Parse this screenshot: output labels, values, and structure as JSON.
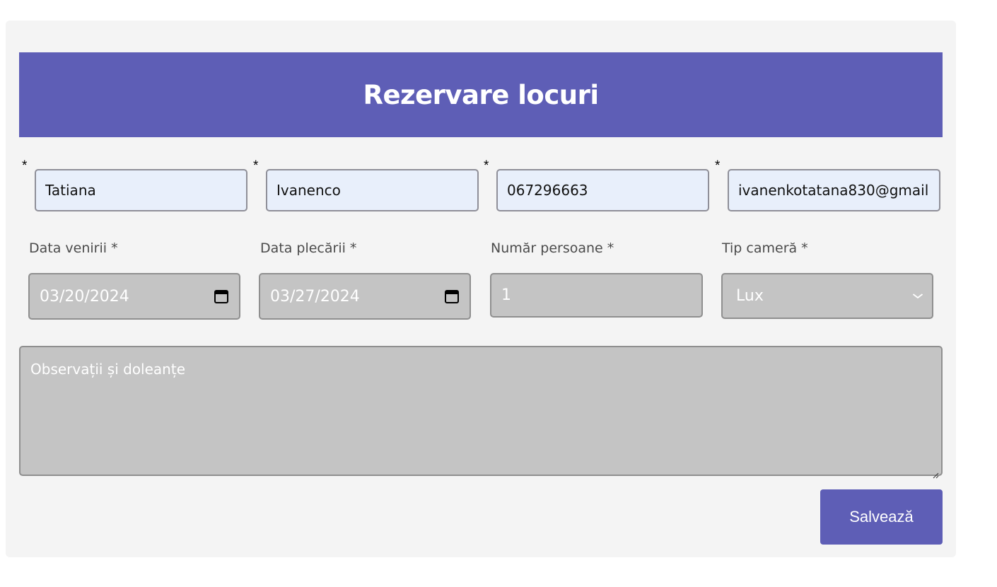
{
  "form": {
    "title": "Rezervare locuri",
    "required_marker": "*",
    "first_name": "Tatiana",
    "last_name": "Ivanenco",
    "phone": "067296663",
    "email": "ivanenkotatana830@gmail",
    "arrival_label": "Data venirii *",
    "arrival_value": "03/20/2024",
    "departure_label": "Data plecării *",
    "departure_value": "03/27/2024",
    "persons_label": "Număr persoane *",
    "persons_value": "1",
    "room_label": "Tip cameră *",
    "room_value": "Lux",
    "notes_placeholder": "Observații și doleanțe",
    "save_label": "Salvează"
  },
  "colors": {
    "accent": "#5e5eb6",
    "card_bg": "#f4f4f4",
    "input_bg": "#e8effb",
    "disabled_bg": "#c4c4c4"
  },
  "icons": {
    "date_picker": "calendar-icon",
    "select": "chevron-down-icon",
    "textarea": "resize-handle-icon"
  }
}
